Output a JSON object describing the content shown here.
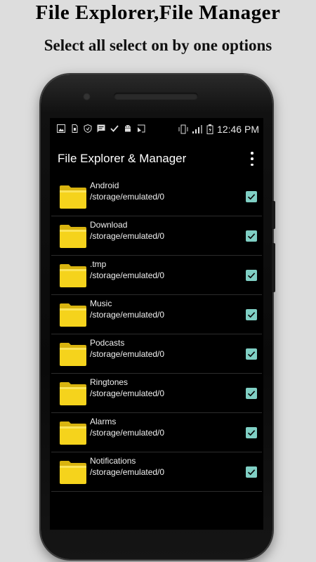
{
  "promo": {
    "title": "File Explorer,File Manager",
    "subtitle": "Select all select on by one options"
  },
  "status_bar": {
    "time": "12:46 PM",
    "left_icons": [
      "image-icon",
      "sim-icon",
      "vpn-shield-icon",
      "message-icon",
      "check-icon",
      "android-icon",
      "cast-icon"
    ],
    "right_icons": [
      "vibrate-icon",
      "signal-icon",
      "battery-icon"
    ]
  },
  "app_bar": {
    "title": "File Explorer & Manager",
    "menu_icon": "more-vert-icon"
  },
  "folders": [
    {
      "name": "Android",
      "path": "/storage/emulated/0",
      "checked": true
    },
    {
      "name": "Download",
      "path": "/storage/emulated/0",
      "checked": true
    },
    {
      "name": ".tmp",
      "path": "/storage/emulated/0",
      "checked": true
    },
    {
      "name": "Music",
      "path": "/storage/emulated/0",
      "checked": true
    },
    {
      "name": "Podcasts",
      "path": "/storage/emulated/0",
      "checked": true
    },
    {
      "name": "Ringtones",
      "path": "/storage/emulated/0",
      "checked": true
    },
    {
      "name": "Alarms",
      "path": "/storage/emulated/0",
      "checked": true
    },
    {
      "name": "Notifications",
      "path": "/storage/emulated/0",
      "checked": true
    }
  ],
  "colors": {
    "checkbox": "#7fcfc4",
    "folder": "#f5d31c",
    "background": "#000000"
  }
}
